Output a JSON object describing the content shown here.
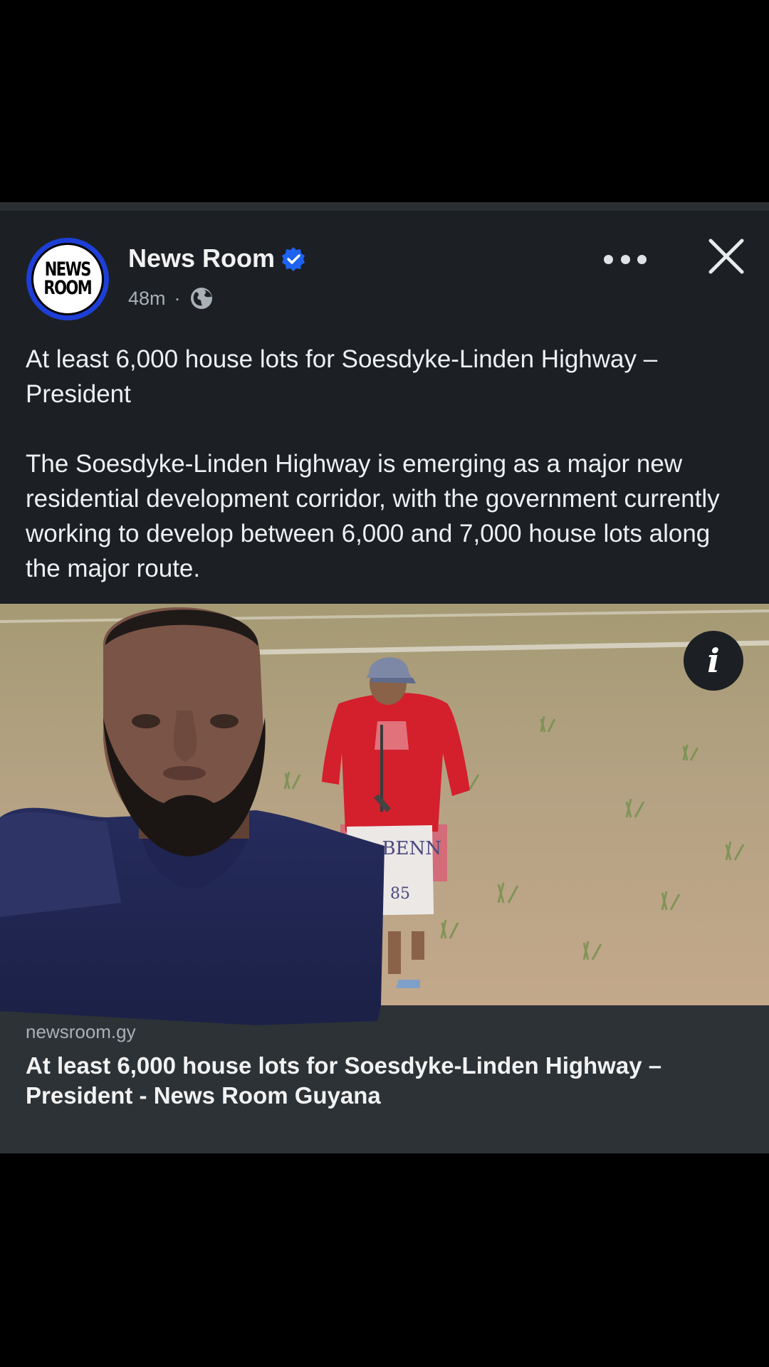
{
  "post": {
    "page_name": "News Room",
    "avatar_text_line1": "NEWS",
    "avatar_text_line2": "ROOM",
    "time": "48m",
    "separator": "·",
    "headline": "At least 6,000 house lots for Soesdyke-Linden Highway – President",
    "body": "The Soesdyke-Linden Highway is emerging as a major new residential development corridor, with the government currently working to develop between 6,000 and 7,000 house lots along the major route.",
    "image_sign_text_1": "D. BENN",
    "image_sign_text_2": "85",
    "info_label": "i"
  },
  "link_preview": {
    "domain": "newsroom.gy",
    "title": "At least 6,000 house lots for Soesdyke-Linden Highway – President - News Room Guyana"
  },
  "colors": {
    "background": "#000000",
    "card": "#1c2024",
    "link_card": "#2c3236",
    "verified_blue": "#1d63f0",
    "avatar_ring": "#1d3fd6"
  },
  "icons": [
    "verified-badge-icon",
    "globe-icon",
    "more-options-icon",
    "close-icon",
    "info-icon"
  ]
}
